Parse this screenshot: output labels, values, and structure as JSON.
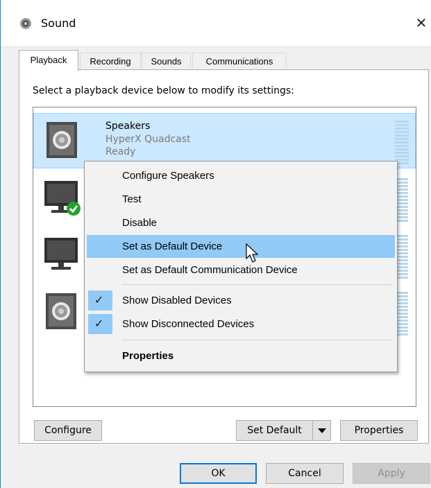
{
  "window": {
    "title": "Sound"
  },
  "tabs": [
    {
      "label": "Playback",
      "active": true
    },
    {
      "label": "Recording",
      "active": false
    },
    {
      "label": "Sounds",
      "active": false
    },
    {
      "label": "Communications",
      "active": false
    }
  ],
  "playback": {
    "instruction": "Select a playback device below to modify its settings:",
    "devices": [
      {
        "name": "Speakers",
        "description": "HyperX Quadcast",
        "status": "Ready",
        "icon": "speaker-icon",
        "selected": true
      },
      {
        "icon": "monitor-icon",
        "default": true
      },
      {
        "icon": "monitor-icon"
      },
      {
        "icon": "speaker-icon"
      }
    ]
  },
  "context_menu": {
    "items": [
      {
        "label": "Configure Speakers"
      },
      {
        "label": "Test"
      },
      {
        "label": "Disable"
      },
      {
        "label": "Set as Default Device",
        "highlighted": true
      },
      {
        "label": "Set as Default Communication Device"
      },
      {
        "label": "Show Disabled Devices",
        "checked": true
      },
      {
        "label": "Show Disconnected Devices",
        "checked": true
      },
      {
        "label": "Properties",
        "bold": true
      }
    ]
  },
  "buttons": {
    "configure": "Configure",
    "set_default": "Set Default",
    "properties": "Properties",
    "ok": "OK",
    "cancel": "Cancel",
    "apply": "Apply"
  },
  "colors": {
    "selection": "#cce8ff",
    "menu_highlight": "#91c9f7",
    "accent": "#0078d7",
    "default_badge": "#1fa32b"
  }
}
